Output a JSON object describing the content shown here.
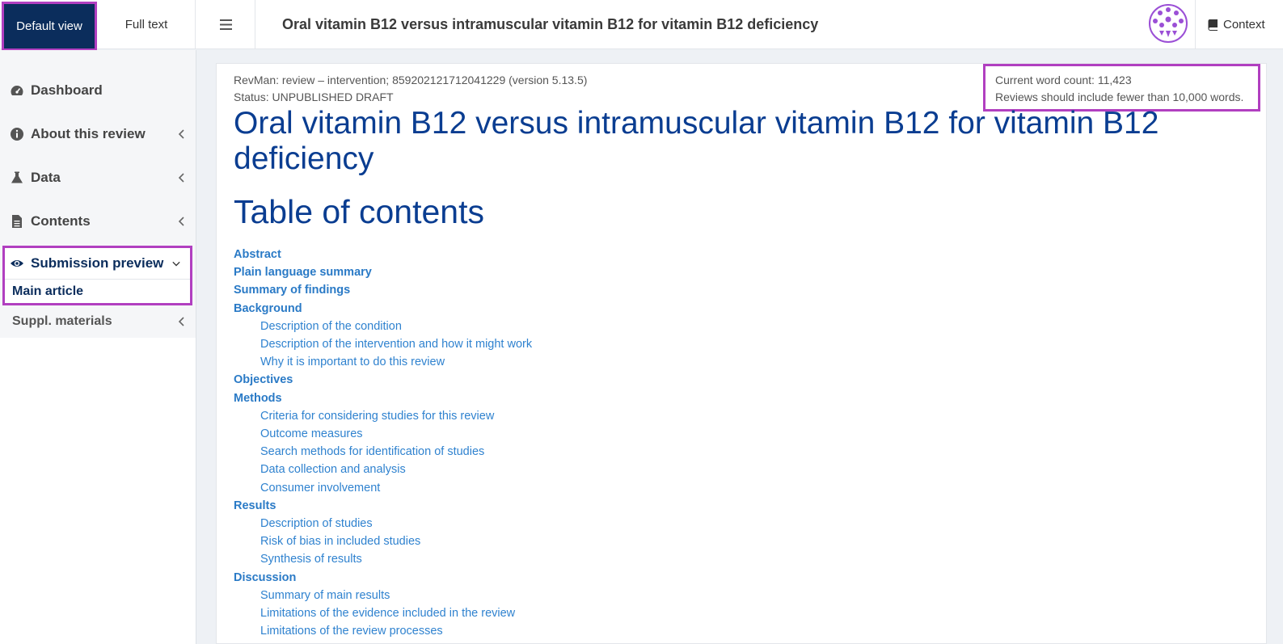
{
  "topbar": {
    "default_view": "Default view",
    "full_text": "Full text",
    "page_heading": "Oral vitamin B12 versus intramuscular vitamin B12 for vitamin B12 deficiency",
    "context": "Context"
  },
  "sidebar": {
    "items": [
      {
        "label": "Dashboard",
        "icon": "dashboard-icon"
      },
      {
        "label": "About this review",
        "icon": "info-icon"
      },
      {
        "label": "Data",
        "icon": "flask-icon"
      },
      {
        "label": "Contents",
        "icon": "document-icon"
      }
    ],
    "submission": {
      "label": "Submission preview",
      "icon": "eye-icon",
      "sub_item": "Main article"
    },
    "supplementary": "Suppl. materials"
  },
  "content": {
    "meta_line1": "RevMan: review – intervention; 859202121712041229 (version 5.13.5)",
    "meta_line2": "Status: UNPUBLISHED DRAFT",
    "wordcount_line1": "Current word count: 11,423",
    "wordcount_line2": "Reviews should include fewer than 10,000 words.",
    "title": "Oral vitamin B12 versus intramuscular vitamin B12 for vitamin B12 deficiency",
    "toc_title": "Table of contents",
    "toc": [
      {
        "label": "Abstract",
        "level": 1
      },
      {
        "label": "Plain language summary",
        "level": 1
      },
      {
        "label": "Summary of findings",
        "level": 1
      },
      {
        "label": "Background",
        "level": 1
      },
      {
        "label": "Description of the condition",
        "level": 2
      },
      {
        "label": "Description of the intervention and how it might work",
        "level": 2
      },
      {
        "label": "Why it is important to do this review",
        "level": 2
      },
      {
        "label": "Objectives",
        "level": 1
      },
      {
        "label": "Methods",
        "level": 1
      },
      {
        "label": "Criteria for considering studies for this review",
        "level": 2
      },
      {
        "label": "Outcome measures",
        "level": 2
      },
      {
        "label": "Search methods for identification of studies",
        "level": 2
      },
      {
        "label": "Data collection and analysis",
        "level": 2
      },
      {
        "label": "Consumer involvement",
        "level": 2
      },
      {
        "label": "Results",
        "level": 1
      },
      {
        "label": "Description of studies",
        "level": 2
      },
      {
        "label": "Risk of bias in included studies",
        "level": 2
      },
      {
        "label": "Synthesis of results",
        "level": 2
      },
      {
        "label": "Discussion",
        "level": 1
      },
      {
        "label": "Summary of main results",
        "level": 2
      },
      {
        "label": "Limitations of the evidence included in the review",
        "level": 2
      },
      {
        "label": "Limitations of the review processes",
        "level": 2
      }
    ]
  },
  "colors": {
    "brand_navy": "#0b2d5c",
    "link_blue": "#2a7ac6",
    "title_blue": "#0a3d91",
    "highlight": "#b13fc0"
  }
}
